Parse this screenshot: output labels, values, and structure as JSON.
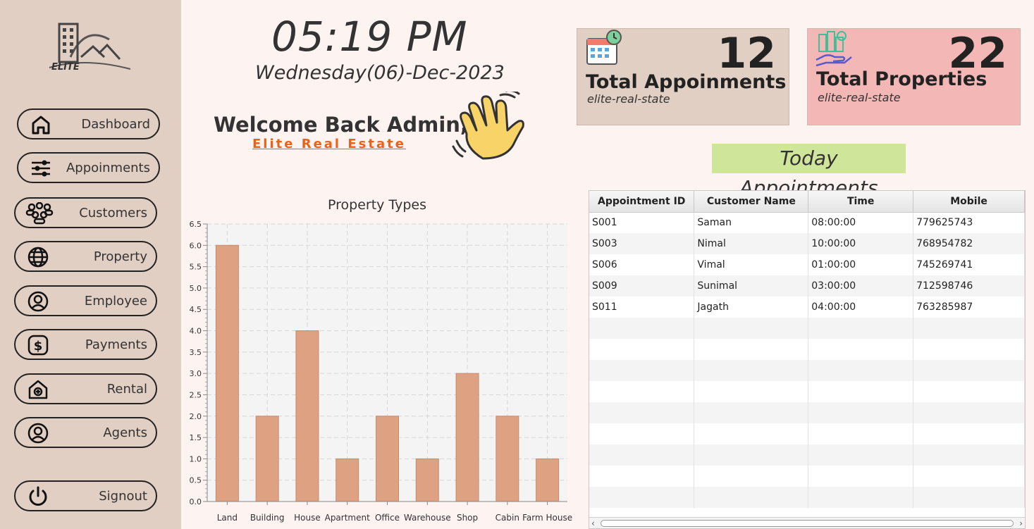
{
  "sidebar": {
    "logo_text": "ELITE",
    "items": [
      {
        "label": "Dashboard",
        "icon": "home-icon"
      },
      {
        "label": "Appoinments",
        "icon": "sliders-icon"
      },
      {
        "label": "Customers",
        "icon": "people-icon"
      },
      {
        "label": "Property",
        "icon": "globe-icon"
      },
      {
        "label": "Employee",
        "icon": "user-circle-icon"
      },
      {
        "label": "Payments",
        "icon": "dollar-icon"
      },
      {
        "label": "Rental",
        "icon": "house-plus-icon"
      },
      {
        "label": "Agents",
        "icon": "user-circle-icon"
      }
    ],
    "signout": {
      "label": "Signout",
      "icon": "power-icon"
    }
  },
  "header": {
    "time": "05:19 PM",
    "date": "Wednesday(06)-Dec-2023",
    "welcome": "Welcome Back Admin,",
    "brand": "Elite Real Estate"
  },
  "cards": [
    {
      "number": "12",
      "title": "Total Appoinments",
      "subtitle": "elite-real-state",
      "icon": "calendar-clock-icon",
      "color": "#e2cfc3"
    },
    {
      "number": "22",
      "title": "Total Properties",
      "subtitle": "elite-real-state",
      "icon": "property-hand-icon",
      "color": "#f3b8b6"
    }
  ],
  "appointments": {
    "title": "Today Appointments",
    "columns": [
      "Appointment ID",
      "Customer Name",
      "Time",
      "Mobile"
    ],
    "rows": [
      [
        "S001",
        "Saman",
        "08:00:00",
        "779625743"
      ],
      [
        "S003",
        "Nimal",
        "10:00:00",
        "768954782"
      ],
      [
        "S006",
        "Vimal",
        "01:00:00",
        "745269741"
      ],
      [
        "S009",
        "Sunimal",
        "03:00:00",
        "712598746"
      ],
      [
        "S011",
        "Jagath",
        "04:00:00",
        "763285987"
      ]
    ]
  },
  "chart_data": {
    "type": "bar",
    "title": "Property Types",
    "categories": [
      "Land",
      "Building",
      "House",
      "Apartment",
      "Office",
      "Warehouse",
      "Shop",
      "Cabin",
      "Farm House"
    ],
    "values": [
      6,
      2,
      4,
      1,
      2,
      1,
      3,
      2,
      1
    ],
    "ylim": [
      0,
      6.5
    ],
    "yticks": [
      "0.0",
      "0.5",
      "1.0",
      "1.5",
      "2.0",
      "2.5",
      "3.0",
      "3.5",
      "4.0",
      "4.5",
      "5.0",
      "5.5",
      "6.0",
      "6.5"
    ],
    "grid": true,
    "bar_color": "#dea283"
  }
}
